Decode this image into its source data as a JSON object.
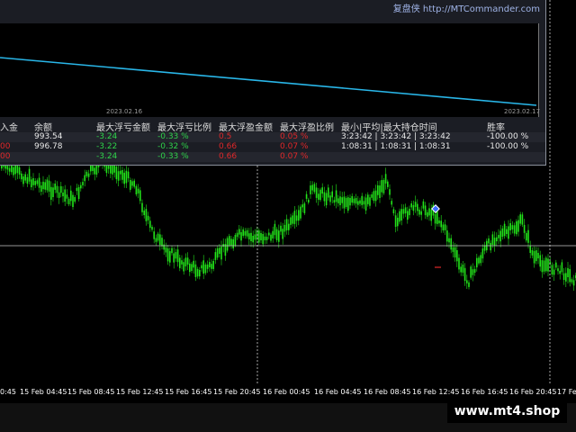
{
  "app": {
    "brand": "复盘侠 http://MTCommander.com"
  },
  "colors": {
    "background": "#000000",
    "candle_up": "#22e31a",
    "panel": "#1b1d24",
    "equity_line": "#29b6e8",
    "positive": "#2fd34a",
    "negative": "#e0282a"
  },
  "equity_panel": {
    "date_left": "2023.02.16",
    "date_right": "2023.02.17"
  },
  "stats": {
    "headers": [
      "入金",
      "余额",
      "最大浮亏金额",
      "最大浮亏比例",
      "最大浮盈金额",
      "最大浮盈比例",
      "最小|平均|最大持仓时间",
      "胜率"
    ],
    "rows": [
      [
        "",
        "993.54",
        "-3.24",
        "-0.33 %",
        "0.5",
        "0.05 %",
        "3:23:42 | 3:23:42 | 3:23:42",
        "-100.00 %"
      ],
      [
        "00",
        "996.78",
        "-3.22",
        "-0.32 %",
        "0.66",
        "0.07 %",
        "1:08:31 | 1:08:31 | 1:08:31",
        "-100.00 %"
      ],
      [
        "00",
        "",
        "-3.24",
        "-0.33 %",
        "0.66",
        "0.07 %",
        "",
        ""
      ]
    ]
  },
  "x_axis": {
    "labels": [
      "0:45",
      "15 Feb 04:45",
      "15 Feb 08:45",
      "15 Feb 12:45",
      "15 Feb 16:45",
      "15 Feb 20:45",
      "16 Feb 00:45",
      "16 Feb 04:45",
      "16 Feb 08:45",
      "16 Feb 12:45",
      "16 Feb 16:45",
      "16 Feb 20:45",
      "17 Fe"
    ]
  },
  "watermark": {
    "text": "www.mt4.shop"
  }
}
